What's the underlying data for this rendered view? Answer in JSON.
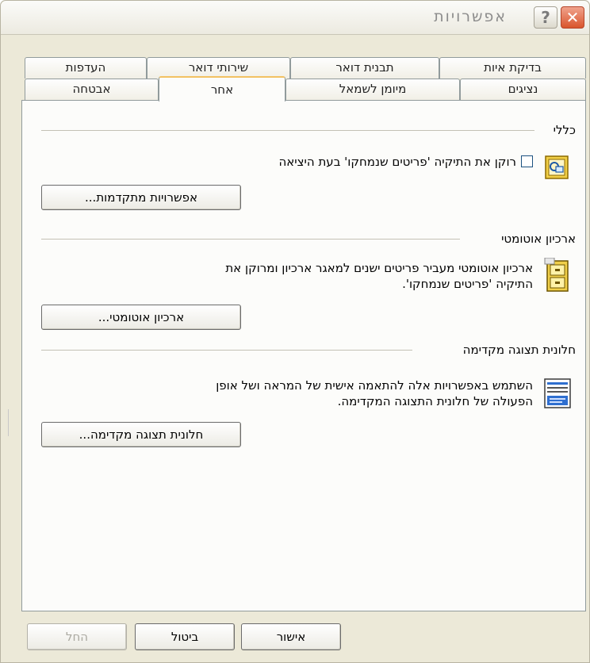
{
  "window": {
    "title": "אפשרויות",
    "help_label": "?",
    "close_label": "✕"
  },
  "tabs": {
    "row1": [
      "בדיקת איות",
      "תבנית דואר",
      "שירותי דואר",
      "העדפות"
    ],
    "row2": [
      "נציגים",
      "מיומן לשמאל",
      "אחר",
      "אבטחה"
    ],
    "active": "אחר"
  },
  "general": {
    "title": "כללי",
    "checkbox_label": "רוקן את התיקיה 'פריטים שנמחקו' בעת היציאה",
    "checkbox_checked": false,
    "advanced_button": "אפשרויות מתקדמות...",
    "icon": "outlook-options-icon"
  },
  "autoarchive": {
    "title": "ארכיון אוטומטי",
    "description_line1": "ארכיון אוטומטי מעביר פריטים ישנים למאגר ארכיון ומרוקן את",
    "description_line2": "התיקיה 'פריטים שנמחקו'.",
    "button": "ארכיון אוטומטי...",
    "icon": "filing-cabinet-icon"
  },
  "preview": {
    "title": "חלונית תצוגה מקדימה",
    "description_line1": "השתמש באפשרויות אלה להתאמה אישית של המראה ושל אופן",
    "description_line2": "הפעולה של חלונית התצוגה המקדימה.",
    "button": "חלונית תצוגה מקדימה...",
    "icon": "preview-pane-icon"
  },
  "footer": {
    "ok": "אישור",
    "cancel": "ביטול",
    "apply": "החל"
  }
}
